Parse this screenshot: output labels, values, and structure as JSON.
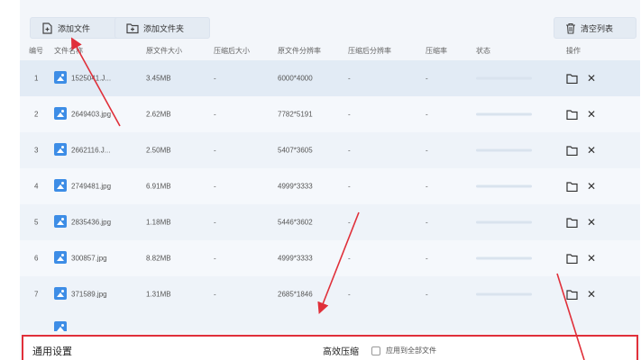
{
  "toolbar": {
    "add_file_label": "添加文件",
    "add_folder_label": "添加文件夹",
    "clear_list_label": "清空列表"
  },
  "table": {
    "headers": [
      "编号",
      "文件名称",
      "原文件大小",
      "压缩后大小",
      "原文件分辨率",
      "压缩后分辨率",
      "压缩率",
      "状态",
      "操作"
    ],
    "rows": [
      {
        "index": "1",
        "name": "1525041.J...",
        "orig_size": "3.45MB",
        "comp_size": "-",
        "orig_res": "6000*4000",
        "comp_res": "-",
        "ratio": "-"
      },
      {
        "index": "2",
        "name": "2649403.jpg",
        "orig_size": "2.62MB",
        "comp_size": "-",
        "orig_res": "7782*5191",
        "comp_res": "-",
        "ratio": "-"
      },
      {
        "index": "3",
        "name": "2662116.J...",
        "orig_size": "2.50MB",
        "comp_size": "-",
        "orig_res": "5407*3605",
        "comp_res": "-",
        "ratio": "-"
      },
      {
        "index": "4",
        "name": "2749481.jpg",
        "orig_size": "6.91MB",
        "comp_size": "-",
        "orig_res": "4999*3333",
        "comp_res": "-",
        "ratio": "-"
      },
      {
        "index": "5",
        "name": "2835436.jpg",
        "orig_size": "1.18MB",
        "comp_size": "-",
        "orig_res": "5446*3602",
        "comp_res": "-",
        "ratio": "-"
      },
      {
        "index": "6",
        "name": "300857.jpg",
        "orig_size": "8.82MB",
        "comp_size": "-",
        "orig_res": "4999*3333",
        "comp_res": "-",
        "ratio": "-"
      },
      {
        "index": "7",
        "name": "371589.jpg",
        "orig_size": "1.31MB",
        "comp_size": "-",
        "orig_res": "2685*1846",
        "comp_res": "-",
        "ratio": "-"
      }
    ]
  },
  "settings": {
    "general_title": "通用设置",
    "efficient_title": "高效压缩",
    "apply_all_label": "应用到全部文件"
  },
  "colors": {
    "accent_red": "#e0303a",
    "file_icon_blue": "#3d8de6"
  }
}
